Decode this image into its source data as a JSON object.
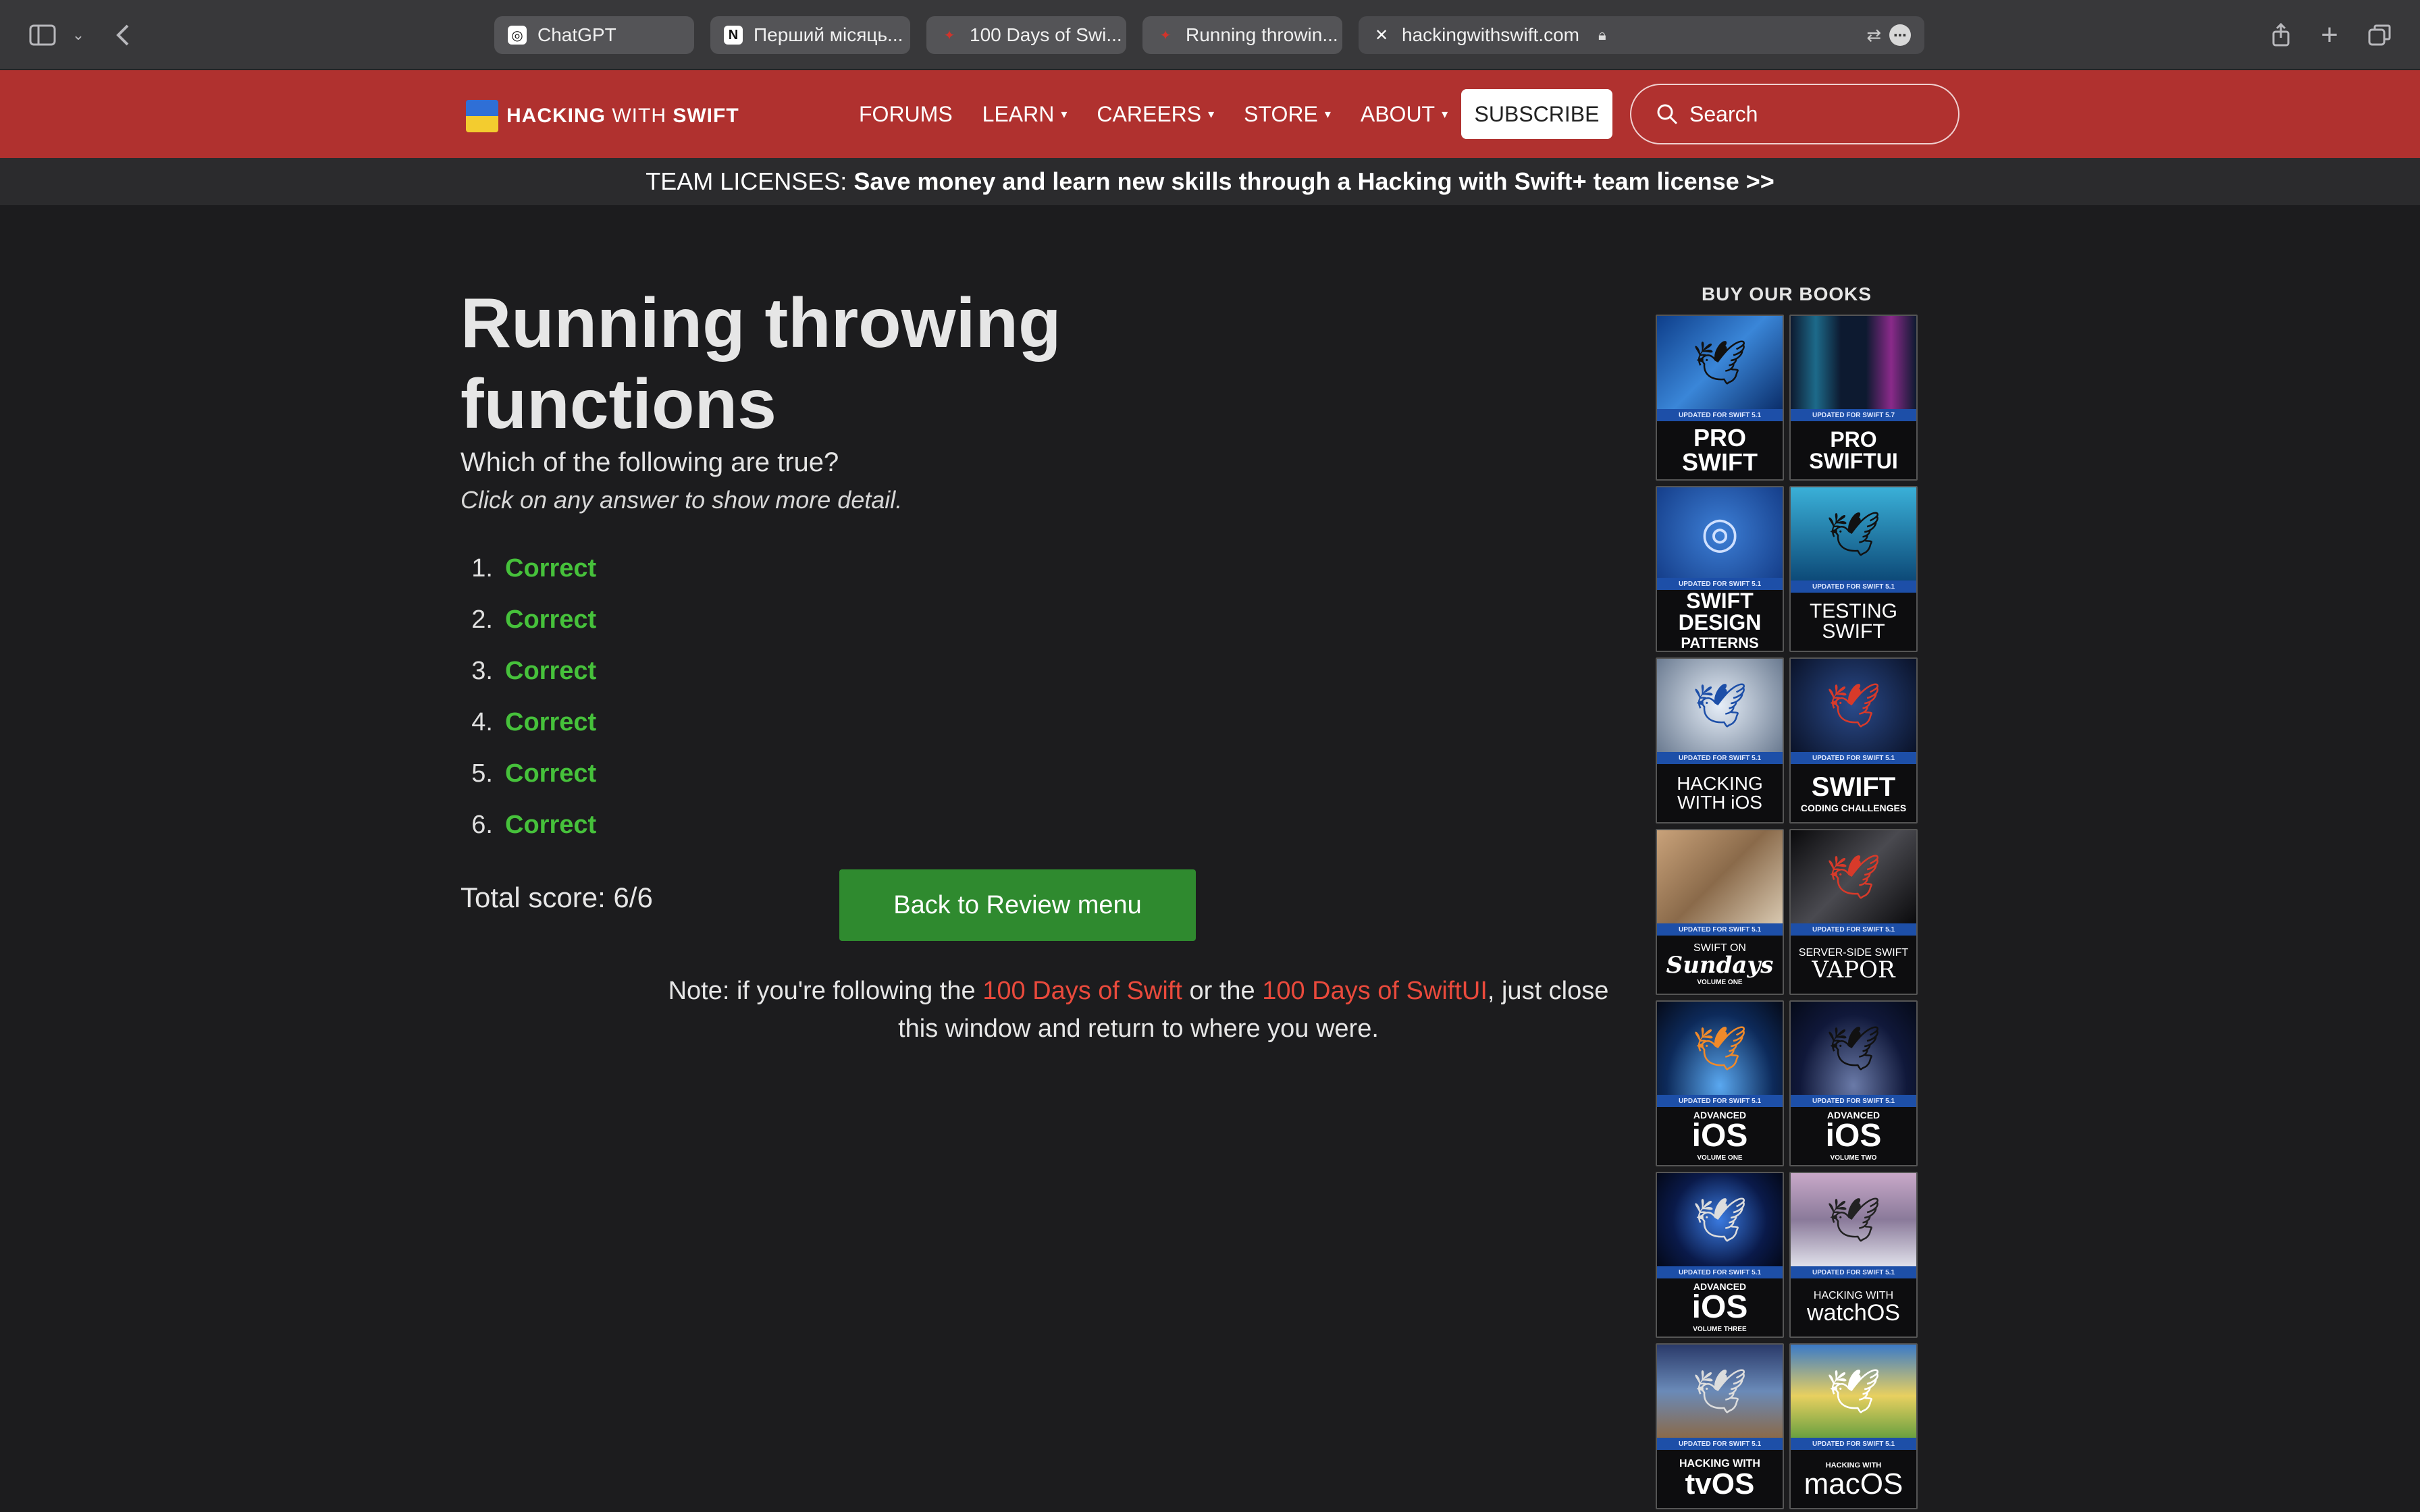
{
  "browser": {
    "tabs": [
      {
        "label": "ChatGPT",
        "icon": "chatgpt-icon"
      },
      {
        "label": "Перший місяць...",
        "icon": "notion-icon"
      },
      {
        "label": "100 Days of Swi...",
        "icon": "hws-icon"
      },
      {
        "label": "Running throwin...",
        "icon": "hws-icon"
      }
    ],
    "address": "hackingwithswift.com"
  },
  "header": {
    "logo_hacking": "HACKING",
    "logo_with": "WITH",
    "logo_swift": "SWIFT",
    "nav": [
      "FORUMS",
      "LEARN",
      "CAREERS",
      "STORE",
      "ABOUT"
    ],
    "subscribe": "SUBSCRIBE",
    "search_placeholder": "Search"
  },
  "promo": {
    "prefix": "TEAM LICENSES:",
    "text": "Save money and learn new skills through a Hacking with Swift+ team license >>"
  },
  "main": {
    "title": "Running throwing functions",
    "question": "Which of the following are true?",
    "hint": "Click on any answer to show more detail.",
    "answers": [
      {
        "num": "1.",
        "label": "Correct"
      },
      {
        "num": "2.",
        "label": "Correct"
      },
      {
        "num": "3.",
        "label": "Correct"
      },
      {
        "num": "4.",
        "label": "Correct"
      },
      {
        "num": "5.",
        "label": "Correct"
      },
      {
        "num": "6.",
        "label": "Correct"
      }
    ],
    "total": "Total score: 6/6",
    "back_button": "Back to Review menu",
    "note": {
      "p1": "Note: if you're following the ",
      "link1": "100 Days of Swift",
      "p2": " or the ",
      "link2": "100 Days of SwiftUI",
      "p3": ", just close this window and return to where you were."
    }
  },
  "sidebar": {
    "heading": "BUY OUR BOOKS",
    "books": [
      {
        "updated": "UPDATED FOR SWIFT 5.1",
        "line1": "PRO",
        "line2": "SWIFT",
        "line3": ""
      },
      {
        "updated": "UPDATED FOR SWIFT 5.7",
        "line1": "PRO",
        "line2": "SWIFTUI",
        "line3": ""
      },
      {
        "updated": "UPDATED FOR SWIFT 5.1",
        "line1": "SWIFT",
        "line2": "DESIGN",
        "line3": "PATTERNS"
      },
      {
        "updated": "UPDATED FOR SWIFT 5.1",
        "line1": "TESTING",
        "line2": "SWIFT",
        "line3": ""
      },
      {
        "updated": "UPDATED FOR SWIFT 5.1",
        "line1": "HACKING",
        "line2": "WITH iOS",
        "line3": ""
      },
      {
        "updated": "UPDATED FOR SWIFT 5.1",
        "line1": "SWIFT",
        "line2": "CODING CHALLENGES",
        "line3": ""
      },
      {
        "updated": "UPDATED FOR SWIFT 5.1",
        "line1": "SWIFT ON",
        "line2": "Sundays",
        "line3": "VOLUME ONE"
      },
      {
        "updated": "UPDATED FOR SWIFT 5.1",
        "line1": "SERVER-SIDE SWIFT",
        "line2": "VAPOR",
        "line3": ""
      },
      {
        "updated": "UPDATED FOR SWIFT 5.1",
        "line1": "ADVANCED",
        "line2": "iOS",
        "line3": "VOLUME ONE"
      },
      {
        "updated": "UPDATED FOR SWIFT 5.1",
        "line1": "ADVANCED",
        "line2": "iOS",
        "line3": "VOLUME TWO"
      },
      {
        "updated": "UPDATED FOR SWIFT 5.1",
        "line1": "ADVANCED",
        "line2": "iOS",
        "line3": "VOLUME THREE"
      },
      {
        "updated": "UPDATED FOR SWIFT 5.1",
        "line1": "HACKING WITH",
        "line2": "watchOS",
        "line3": ""
      },
      {
        "updated": "UPDATED FOR SWIFT 5.1",
        "line1": "HACKING WITH",
        "line2": "tvOS",
        "line3": ""
      },
      {
        "updated": "UPDATED FOR SWIFT 5.1",
        "line1": "HACKING WITH",
        "line2": "macOS",
        "line3": ""
      }
    ]
  },
  "colors": {
    "brand_red": "#b0312f",
    "correct_green": "#46c13b",
    "link_red": "#ea4a3c",
    "button_green": "#2f8a2f"
  }
}
